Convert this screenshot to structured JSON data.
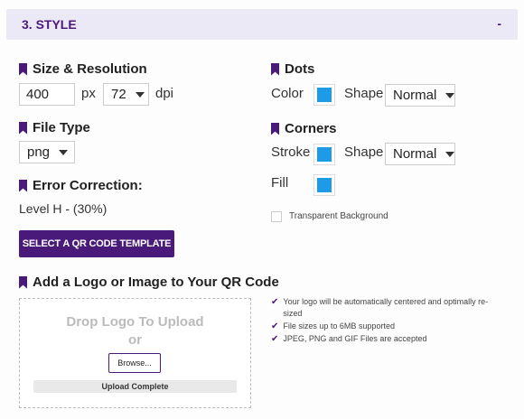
{
  "header": {
    "title": "3. STYLE",
    "toggle": "-"
  },
  "size": {
    "title": "Size & Resolution",
    "width_value": "400",
    "unit_px": "px",
    "dpi_value": "72",
    "unit_dpi": "dpi"
  },
  "file_type": {
    "title": "File Type",
    "value": "png"
  },
  "error_correction": {
    "title": "Error Correction:",
    "value": "Level H - (30%)"
  },
  "template_button": {
    "label": "SELECT A QR CODE TEMPLATE"
  },
  "dots": {
    "title": "Dots",
    "color_label": "Color",
    "shape_label": "Shape",
    "shape_value": "Normal",
    "color": "#1e9be8"
  },
  "corners": {
    "title": "Corners",
    "stroke_label": "Stroke",
    "shape_label": "Shape",
    "shape_value": "Normal",
    "fill_label": "Fill",
    "stroke_color": "#1e9be8",
    "fill_color": "#1e9be8"
  },
  "transparent_bg": {
    "label": "Transparent Background",
    "checked": false
  },
  "logo": {
    "title": "Add a Logo or Image to Your QR Code",
    "drop_line1": "Drop Logo To Upload",
    "drop_line2": "or",
    "browse_label": "Browse...",
    "upload_status": "Upload Complete",
    "upload_progress": 1.0
  },
  "notes": [
    "Your logo will be automatically centered and optimally re-sized",
    "File sizes up to 6MB supported",
    "JPEG, PNG and GIF Files are accepted"
  ],
  "colors": {
    "accent": "#4a1a7a",
    "header_bg": "#ece9f7",
    "swatch": "#1e9be8"
  }
}
